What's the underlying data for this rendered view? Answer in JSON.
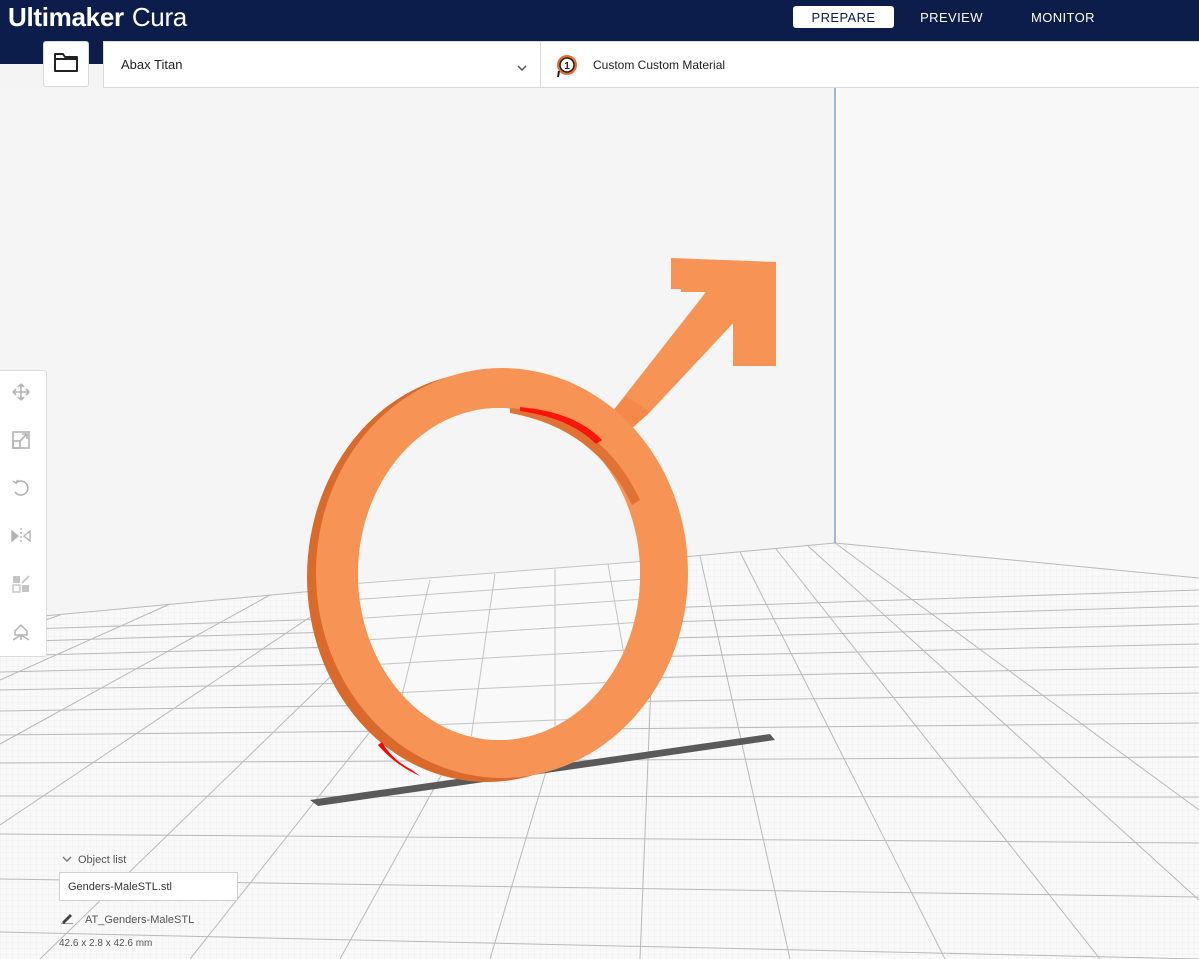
{
  "app": {
    "brand_bold": "Ultimaker",
    "brand_light": "Cura"
  },
  "stages": [
    {
      "label": "PREPARE",
      "active": true
    },
    {
      "label": "PREVIEW",
      "active": false
    },
    {
      "label": "MONITOR",
      "active": false
    }
  ],
  "printer": {
    "name": "Abax Titan"
  },
  "material": {
    "extruder_number": "1",
    "name": "Custom Custom Material"
  },
  "tools": [
    "move-icon",
    "scale-icon",
    "rotate-icon",
    "mirror-icon",
    "per-model-settings-icon",
    "support-blocker-icon"
  ],
  "object_list": {
    "header": "Object list",
    "file": "Genders-MaleSTL.stl",
    "object_name": "AT_Genders-MaleSTL",
    "dimensions": "42.6 x 2.8 x 42.6 mm"
  },
  "colors": {
    "topbar": "#0c1d4c",
    "model": "#f79455",
    "model_shadow": "#e07333",
    "overhang": "#ff0000"
  }
}
